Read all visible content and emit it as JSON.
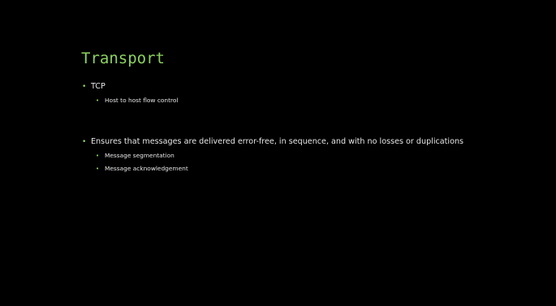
{
  "slide": {
    "title": "Transport",
    "accent_color": "#8dd35f",
    "background_color": "#000000",
    "bullets": [
      {
        "text": "TCP",
        "sub": [
          "Host to host flow control"
        ]
      },
      {
        "text": "Ensures that messages are delivered error-free, in sequence, and with no losses or duplications",
        "sub": [
          "Message segmentation",
          "Message acknowledgement"
        ]
      }
    ]
  }
}
